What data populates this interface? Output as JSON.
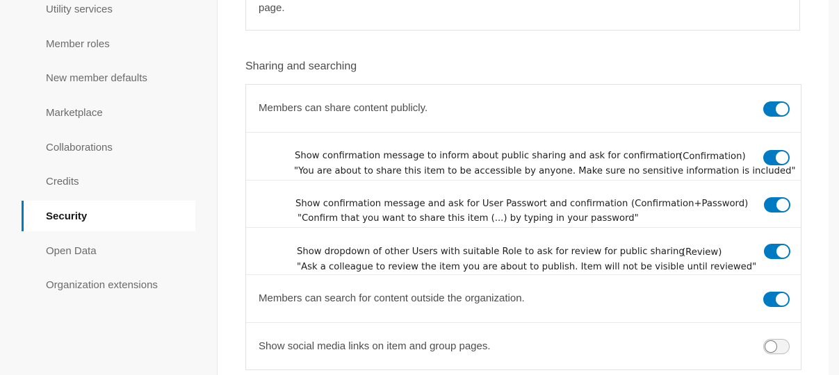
{
  "sidebar": {
    "items": [
      {
        "label": "Utility services",
        "active": false
      },
      {
        "label": "Member roles",
        "active": false
      },
      {
        "label": "New member defaults",
        "active": false
      },
      {
        "label": "Marketplace",
        "active": false
      },
      {
        "label": "Collaborations",
        "active": false
      },
      {
        "label": "Credits",
        "active": false
      },
      {
        "label": "Security",
        "active": true
      },
      {
        "label": "Open Data",
        "active": false
      },
      {
        "label": "Organization extensions",
        "active": false
      }
    ]
  },
  "top_card": {
    "text": "page."
  },
  "section": {
    "title": "Sharing and searching"
  },
  "settings": {
    "share_publicly": {
      "label": "Members can share content publicly.",
      "enabled": true
    },
    "confirmation": {
      "text": "Show confirmation message to inform about public sharing and ask for confirmation",
      "tag": "(Confirmation)",
      "quote": "\"You are about to share this item to be accessible by anyone. Make sure no sensitive information is included\"",
      "enabled": true
    },
    "confirmation_password": {
      "text": "Show confirmation message and ask for User Passwort and confirmation",
      "tag": "(Confirmation+Password)",
      "quote": "\"Confirm that you want to share this item (...) by typing in your password\"",
      "enabled": true
    },
    "review": {
      "text": "Show dropdown of other Users with suitable Role to ask for review for public sharing",
      "tag": "(Review)",
      "quote": "\"Ask a colleague to review the item you are about to publish. Item will not be visible until reviewed\"",
      "enabled": true
    },
    "search_outside": {
      "label": "Members can search for content outside the organization.",
      "enabled": true
    },
    "social_links": {
      "label": "Show social media links on item and group pages.",
      "enabled": false
    }
  },
  "colors": {
    "accent": "#007ac2",
    "sidebar_bg": "#f8f8f8",
    "border": "#e2e2e2"
  }
}
